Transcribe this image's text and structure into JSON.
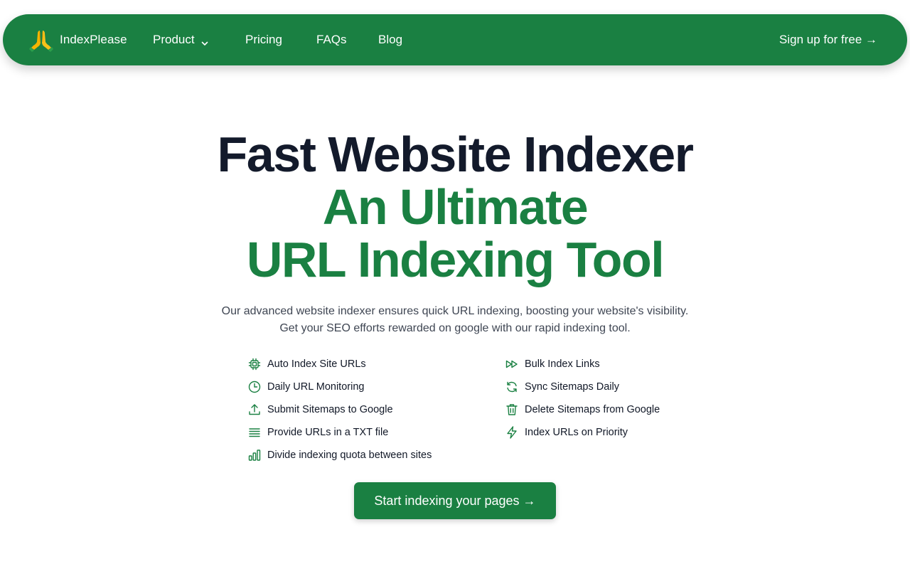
{
  "nav": {
    "brand": "IndexPlease",
    "brand_icon": "folded-hands-icon",
    "items": [
      {
        "label": "Product",
        "has_dropdown": true
      },
      {
        "label": "Pricing"
      },
      {
        "label": "FAQs"
      },
      {
        "label": "Blog"
      }
    ],
    "signup_label": "Sign up for free →"
  },
  "hero": {
    "title_line1": "Fast Website Indexer",
    "title_line2": "An Ultimate",
    "title_line3": "URL Indexing Tool",
    "subtitle_line1": "Our advanced website indexer ensures quick URL indexing, boosting your website's visibility.",
    "subtitle_line2": "Get your SEO efforts rewarded on google with our rapid indexing tool."
  },
  "features": {
    "left": [
      {
        "label": "Auto Index Site URLs",
        "icon": "chip-icon"
      },
      {
        "label": "Daily URL Monitoring",
        "icon": "clock-icon"
      },
      {
        "label": "Submit Sitemaps to Google",
        "icon": "upload-icon"
      },
      {
        "label": "Provide URLs in a TXT file",
        "icon": "list-lines-icon"
      },
      {
        "label": "Divide indexing quota between sites",
        "icon": "bar-chart-icon"
      }
    ],
    "right": [
      {
        "label": "Bulk Index Links",
        "icon": "fast-forward-icon"
      },
      {
        "label": "Sync Sitemaps Daily",
        "icon": "refresh-icon"
      },
      {
        "label": "Delete Sitemaps from Google",
        "icon": "trash-icon"
      },
      {
        "label": "Index URLs on Priority",
        "icon": "lightning-icon"
      }
    ]
  },
  "cta": {
    "label": "Start indexing your pages →"
  },
  "colors": {
    "brand_green": "#1a8042",
    "title_dark": "#131a2b",
    "subtitle_gray": "#3f4653"
  }
}
